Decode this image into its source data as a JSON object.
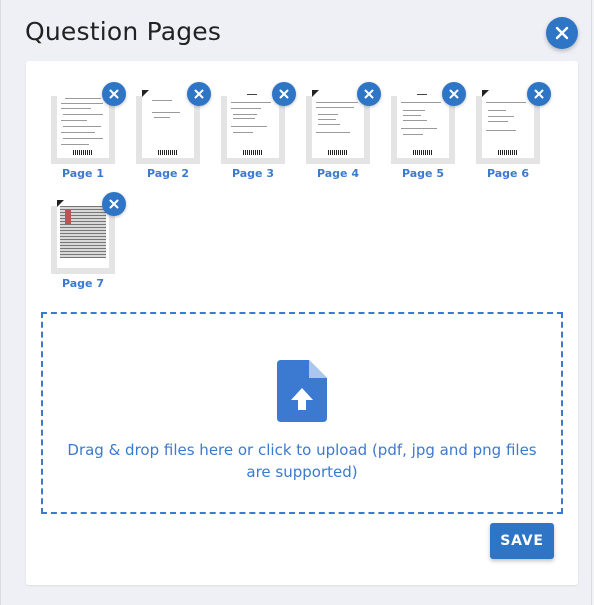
{
  "title": "Question Pages",
  "pages": [
    {
      "label": "Page 1"
    },
    {
      "label": "Page 2"
    },
    {
      "label": "Page 3"
    },
    {
      "label": "Page 4"
    },
    {
      "label": "Page 5"
    },
    {
      "label": "Page 6"
    },
    {
      "label": "Page 7"
    }
  ],
  "dropzone": {
    "text": "Drag & drop files here or click to upload (pdf, jpg and png files are supported)"
  },
  "save_label": "SAVE",
  "icons": {
    "close": "close-icon",
    "remove": "close-icon",
    "upload": "file-upload-icon"
  },
  "colors": {
    "accent": "#2f75c5",
    "link": "#3b7ad0"
  }
}
